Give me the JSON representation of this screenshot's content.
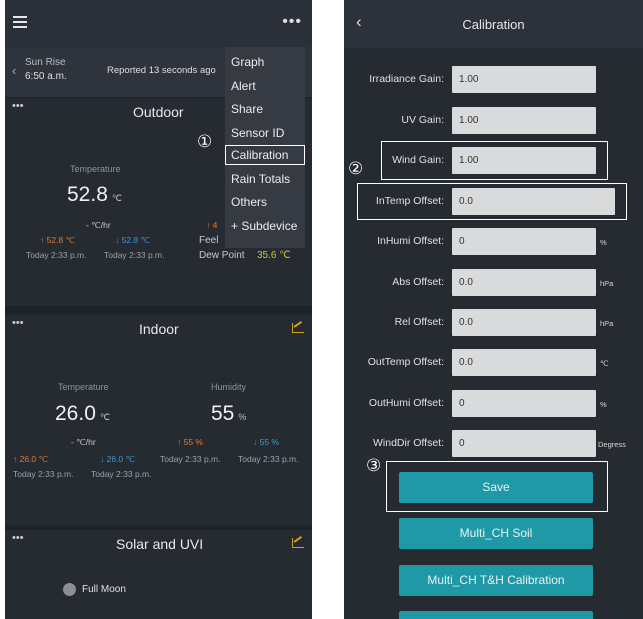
{
  "left_screen": {
    "sun": {
      "label": "Sun Rise",
      "value": "6:50 a.m."
    },
    "reported": "Reported 13 seconds ago",
    "menu_items": [
      "Graph",
      "Alert",
      "Share",
      "Sensor ID",
      "Calibration",
      "Rain Totals",
      "Others",
      "+ Subdevice"
    ],
    "outdoor": {
      "title": "Outdoor",
      "temp_label": "Temperature",
      "temp_value": "52.8",
      "temp_unit": "℃",
      "rate": "- ℃/hr",
      "high": "↑ 52.8 ℃",
      "low": "↓ 52.8 ℃",
      "high_time": "Today 2:33 p.m.",
      "low_time": "Today 2:33 p.m.",
      "feels": "Feel",
      "partial": "↑ 4",
      "dew_label": "Dew Point",
      "dew_value": "35.6 ℃"
    },
    "indoor": {
      "title": "Indoor",
      "temp_label": "Temperature",
      "hum_label": "Humidity",
      "temp_value": "26.0",
      "temp_unit": "℃",
      "hum_value": "55",
      "hum_unit": "%",
      "rate": "- ℃/hr",
      "temp_high": "↑ 26.0 ℃",
      "temp_low": "↓ 26.0 ℃",
      "hum_high": "↑ 55 %",
      "hum_low": "↓ 55 %",
      "time": "Today 2:33 p.m."
    },
    "solar": {
      "title": "Solar and UVI",
      "moon": "Full Moon"
    },
    "annotation": "①"
  },
  "right_screen": {
    "title": "Calibration",
    "fields": [
      {
        "label": "Irradiance Gain:",
        "value": "1.00",
        "unit": ""
      },
      {
        "label": "UV Gain:",
        "value": "1.00",
        "unit": ""
      },
      {
        "label": "Wind Gain:",
        "value": "1.00",
        "unit": ""
      },
      {
        "label": "InTemp Offset:",
        "value": "0.0",
        "unit": "℃"
      },
      {
        "label": "InHumi Offset:",
        "value": "0",
        "unit": "%"
      },
      {
        "label": "Abs Offset:",
        "value": "0.0",
        "unit": "hPa"
      },
      {
        "label": "Rel Offset:",
        "value": "0.0",
        "unit": "hPa"
      },
      {
        "label": "OutTemp Offset:",
        "value": "0.0",
        "unit": "℃"
      },
      {
        "label": "OutHumi Offset:",
        "value": "0",
        "unit": "%"
      },
      {
        "label": "WindDir Offset:",
        "value": "0",
        "unit": "Degress"
      }
    ],
    "buttons": {
      "save": "Save",
      "soil": "Multi_CH Soil",
      "th": "Multi_CH T&H Calibration"
    },
    "annotations": [
      "②",
      "③"
    ]
  },
  "colors": {
    "accent": "#1f99a5",
    "high": "#e07b2e",
    "low": "#3a9bd6",
    "chart": "#d2a11c"
  }
}
